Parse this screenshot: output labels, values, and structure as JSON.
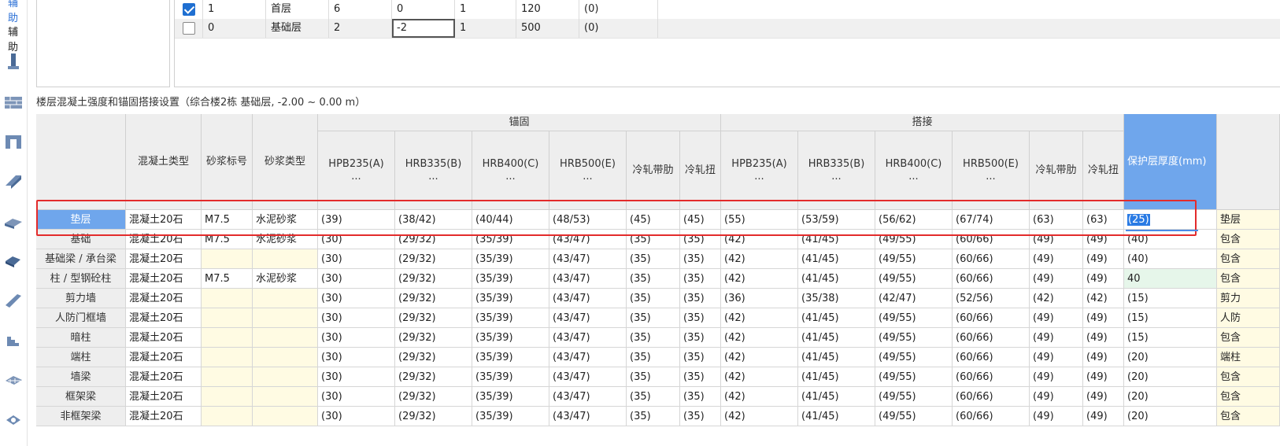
{
  "rail": {
    "tab_top": "辅助",
    "tab_second": "辅助"
  },
  "floors": {
    "rows": [
      {
        "checked": true,
        "code": "1",
        "name": "首层",
        "height": "6",
        "bottom": "0",
        "same": "1",
        "slab": "120",
        "area": "(0)"
      },
      {
        "checked": false,
        "code": "0",
        "name": "基础层",
        "height": "2",
        "bottom": "-2",
        "same": "1",
        "slab": "500",
        "area": "(0)"
      }
    ]
  },
  "caption": "楼层混凝土强度和锚固搭接设置（综合楼2栋  基础层, -2.00 ~ 0.00 m）",
  "grid": {
    "headers": {
      "concrete_type": "混凝土类型",
      "mortar_grade": "砂浆标号",
      "mortar_type": "砂浆类型",
      "anchorage_group": "锚固",
      "lap_group": "搭接",
      "hpb235": "HPB235(A)",
      "hrb335": "HRB335(B)",
      "hrb400": "HRB400(C)",
      "hrb500": "HRB500(E)",
      "more": "...",
      "cold_ribbed": "冷轧带肋",
      "cold_twisted": "冷轧扭",
      "cover": "保护层厚度(mm)"
    },
    "rows": [
      {
        "name": "垫层",
        "type": "混凝土20石",
        "grade": "M7.5",
        "mortar": "水泥砂浆",
        "a1": "(39)",
        "a2": "(38/42)",
        "a3": "(40/44)",
        "a4": "(48/53)",
        "a5": "(45)",
        "a6": "(45)",
        "l1": "(55)",
        "l2": "(53/59)",
        "l3": "(56/62)",
        "l4": "(67/74)",
        "l5": "(63)",
        "l6": "(63)",
        "cover": "(25)",
        "note": "垫层"
      },
      {
        "name": "基础",
        "type": "混凝土20石",
        "grade": "M7.5",
        "mortar": "水泥砂浆",
        "a1": "(30)",
        "a2": "(29/32)",
        "a3": "(35/39)",
        "a4": "(43/47)",
        "a5": "(35)",
        "a6": "(35)",
        "l1": "(42)",
        "l2": "(41/45)",
        "l3": "(49/55)",
        "l4": "(60/66)",
        "l5": "(49)",
        "l6": "(49)",
        "cover": "(40)",
        "note": "包含"
      },
      {
        "name": "基础梁 / 承台梁",
        "type": "混凝土20石",
        "grade": "",
        "mortar": "",
        "a1": "(30)",
        "a2": "(29/32)",
        "a3": "(35/39)",
        "a4": "(43/47)",
        "a5": "(35)",
        "a6": "(35)",
        "l1": "(42)",
        "l2": "(41/45)",
        "l3": "(49/55)",
        "l4": "(60/66)",
        "l5": "(49)",
        "l6": "(49)",
        "cover": "(40)",
        "note": "包含"
      },
      {
        "name": "柱 / 型钢砼柱",
        "type": "混凝土20石",
        "grade": "M7.5",
        "mortar": "水泥砂浆",
        "a1": "(30)",
        "a2": "(29/32)",
        "a3": "(35/39)",
        "a4": "(43/47)",
        "a5": "(35)",
        "a6": "(35)",
        "l1": "(42)",
        "l2": "(41/45)",
        "l3": "(49/55)",
        "l4": "(60/66)",
        "l5": "(49)",
        "l6": "(49)",
        "cover": "40",
        "note": "包含"
      },
      {
        "name": "剪力墙",
        "type": "混凝土20石",
        "grade": "",
        "mortar": "",
        "a1": "(30)",
        "a2": "(29/32)",
        "a3": "(35/39)",
        "a4": "(43/47)",
        "a5": "(35)",
        "a6": "(35)",
        "l1": "(36)",
        "l2": "(35/38)",
        "l3": "(42/47)",
        "l4": "(52/56)",
        "l5": "(42)",
        "l6": "(42)",
        "cover": "(15)",
        "note": "剪力"
      },
      {
        "name": "人防门框墙",
        "type": "混凝土20石",
        "grade": "",
        "mortar": "",
        "a1": "(30)",
        "a2": "(29/32)",
        "a3": "(35/39)",
        "a4": "(43/47)",
        "a5": "(35)",
        "a6": "(35)",
        "l1": "(42)",
        "l2": "(41/45)",
        "l3": "(49/55)",
        "l4": "(60/66)",
        "l5": "(49)",
        "l6": "(49)",
        "cover": "(15)",
        "note": "人防"
      },
      {
        "name": "暗柱",
        "type": "混凝土20石",
        "grade": "",
        "mortar": "",
        "a1": "(30)",
        "a2": "(29/32)",
        "a3": "(35/39)",
        "a4": "(43/47)",
        "a5": "(35)",
        "a6": "(35)",
        "l1": "(42)",
        "l2": "(41/45)",
        "l3": "(49/55)",
        "l4": "(60/66)",
        "l5": "(49)",
        "l6": "(49)",
        "cover": "(15)",
        "note": "包含"
      },
      {
        "name": "端柱",
        "type": "混凝土20石",
        "grade": "",
        "mortar": "",
        "a1": "(30)",
        "a2": "(29/32)",
        "a3": "(35/39)",
        "a4": "(43/47)",
        "a5": "(35)",
        "a6": "(35)",
        "l1": "(42)",
        "l2": "(41/45)",
        "l3": "(49/55)",
        "l4": "(60/66)",
        "l5": "(49)",
        "l6": "(49)",
        "cover": "(20)",
        "note": "端柱"
      },
      {
        "name": "墙梁",
        "type": "混凝土20石",
        "grade": "",
        "mortar": "",
        "a1": "(30)",
        "a2": "(29/32)",
        "a3": "(35/39)",
        "a4": "(43/47)",
        "a5": "(35)",
        "a6": "(35)",
        "l1": "(42)",
        "l2": "(41/45)",
        "l3": "(49/55)",
        "l4": "(60/66)",
        "l5": "(49)",
        "l6": "(49)",
        "cover": "(20)",
        "note": "包含"
      },
      {
        "name": "框架梁",
        "type": "混凝土20石",
        "grade": "",
        "mortar": "",
        "a1": "(30)",
        "a2": "(29/32)",
        "a3": "(35/39)",
        "a4": "(43/47)",
        "a5": "(35)",
        "a6": "(35)",
        "l1": "(42)",
        "l2": "(41/45)",
        "l3": "(49/55)",
        "l4": "(60/66)",
        "l5": "(49)",
        "l6": "(49)",
        "cover": "(20)",
        "note": "包含"
      },
      {
        "name": "非框架梁",
        "type": "混凝土20石",
        "grade": "",
        "mortar": "",
        "a1": "(30)",
        "a2": "(29/32)",
        "a3": "(35/39)",
        "a4": "(43/47)",
        "a5": "(35)",
        "a6": "(35)",
        "l1": "(42)",
        "l2": "(41/45)",
        "l3": "(49/55)",
        "l4": "(60/66)",
        "l5": "(49)",
        "l6": "(49)",
        "cover": "(20)",
        "note": "包含"
      }
    ]
  },
  "icons": [
    "column-icon",
    "wall-icon",
    "door-window-icon",
    "beam-icon",
    "slab-icon",
    "stair-icon",
    "decoration-icon",
    "earthwork-icon",
    "foundation-icon",
    "other-icon"
  ],
  "colors": {
    "header_bg": "#eeeeee",
    "selected_header": "#6fa6ec",
    "highlight_border": "#e32b2b",
    "yellow_cell": "#fffbe3",
    "check_blue": "#1f6fd1"
  }
}
